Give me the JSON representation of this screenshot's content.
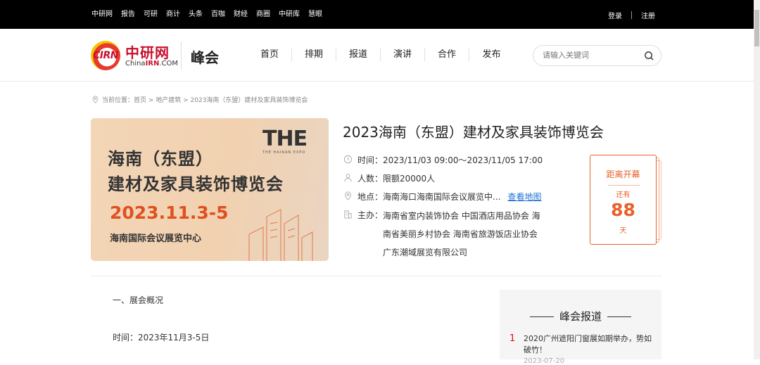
{
  "topbar": {
    "links": [
      "中研网",
      "报告",
      "可研",
      "商计",
      "头条",
      "百咖",
      "财经",
      "商圈",
      "中研库",
      "慧眼"
    ],
    "login": "登录",
    "register": "注册"
  },
  "header": {
    "logo_cn": "中研网",
    "logo_badge": "CIRN",
    "logo_en_prefix": "China",
    "logo_en_mid": "IRN",
    "logo_en_suffix": ".COM",
    "brand": "峰会",
    "nav": [
      "首页",
      "排期",
      "报道",
      "演讲",
      "合作",
      "发布"
    ],
    "search_placeholder": "请输入关键词"
  },
  "breadcrumb": "当前位置：首页 > 地产建筑 > 2023海南（东盟）建材及家具装饰博览会",
  "poster": {
    "line1": "海南（东盟）",
    "line2": "建材及家具装饰博览会",
    "date": "2023.11.3-5",
    "venue": "海南国际会议展览中心",
    "logo": "THE",
    "logo_sub": "THE HAINAN EXPO"
  },
  "event": {
    "title": "2023海南（东盟）建材及家具装饰博览会",
    "time": "时间：2023/11/03 09:00～2023/11/05 17:00",
    "people": "人数：限额20000人",
    "location": "地点：海南海口海南国际会议展览中...",
    "map_link": "查看地图",
    "organizer_label": "主办：",
    "organizer": "海南省室内装饰协会 中国酒店用品协会 海南省美丽乡村协会 海南省旅游饭店业协会 广东潮域展览有限公司"
  },
  "countdown": {
    "title": "距离开幕",
    "prefix": "还有",
    "days": "88",
    "unit": "天"
  },
  "content": {
    "section1": "一、展会概况",
    "time_line": "时间：2023年11月3-5日"
  },
  "sidebar": {
    "heading": "峰会报道",
    "items": [
      {
        "index": "1",
        "title": "2020广州遮阳门窗展如期举办，势如破竹！",
        "date": "2023-07-20"
      }
    ]
  },
  "colors": {
    "accent": "#e8612c",
    "brand_red": "#c8102e",
    "link": "#1d6fd6"
  }
}
